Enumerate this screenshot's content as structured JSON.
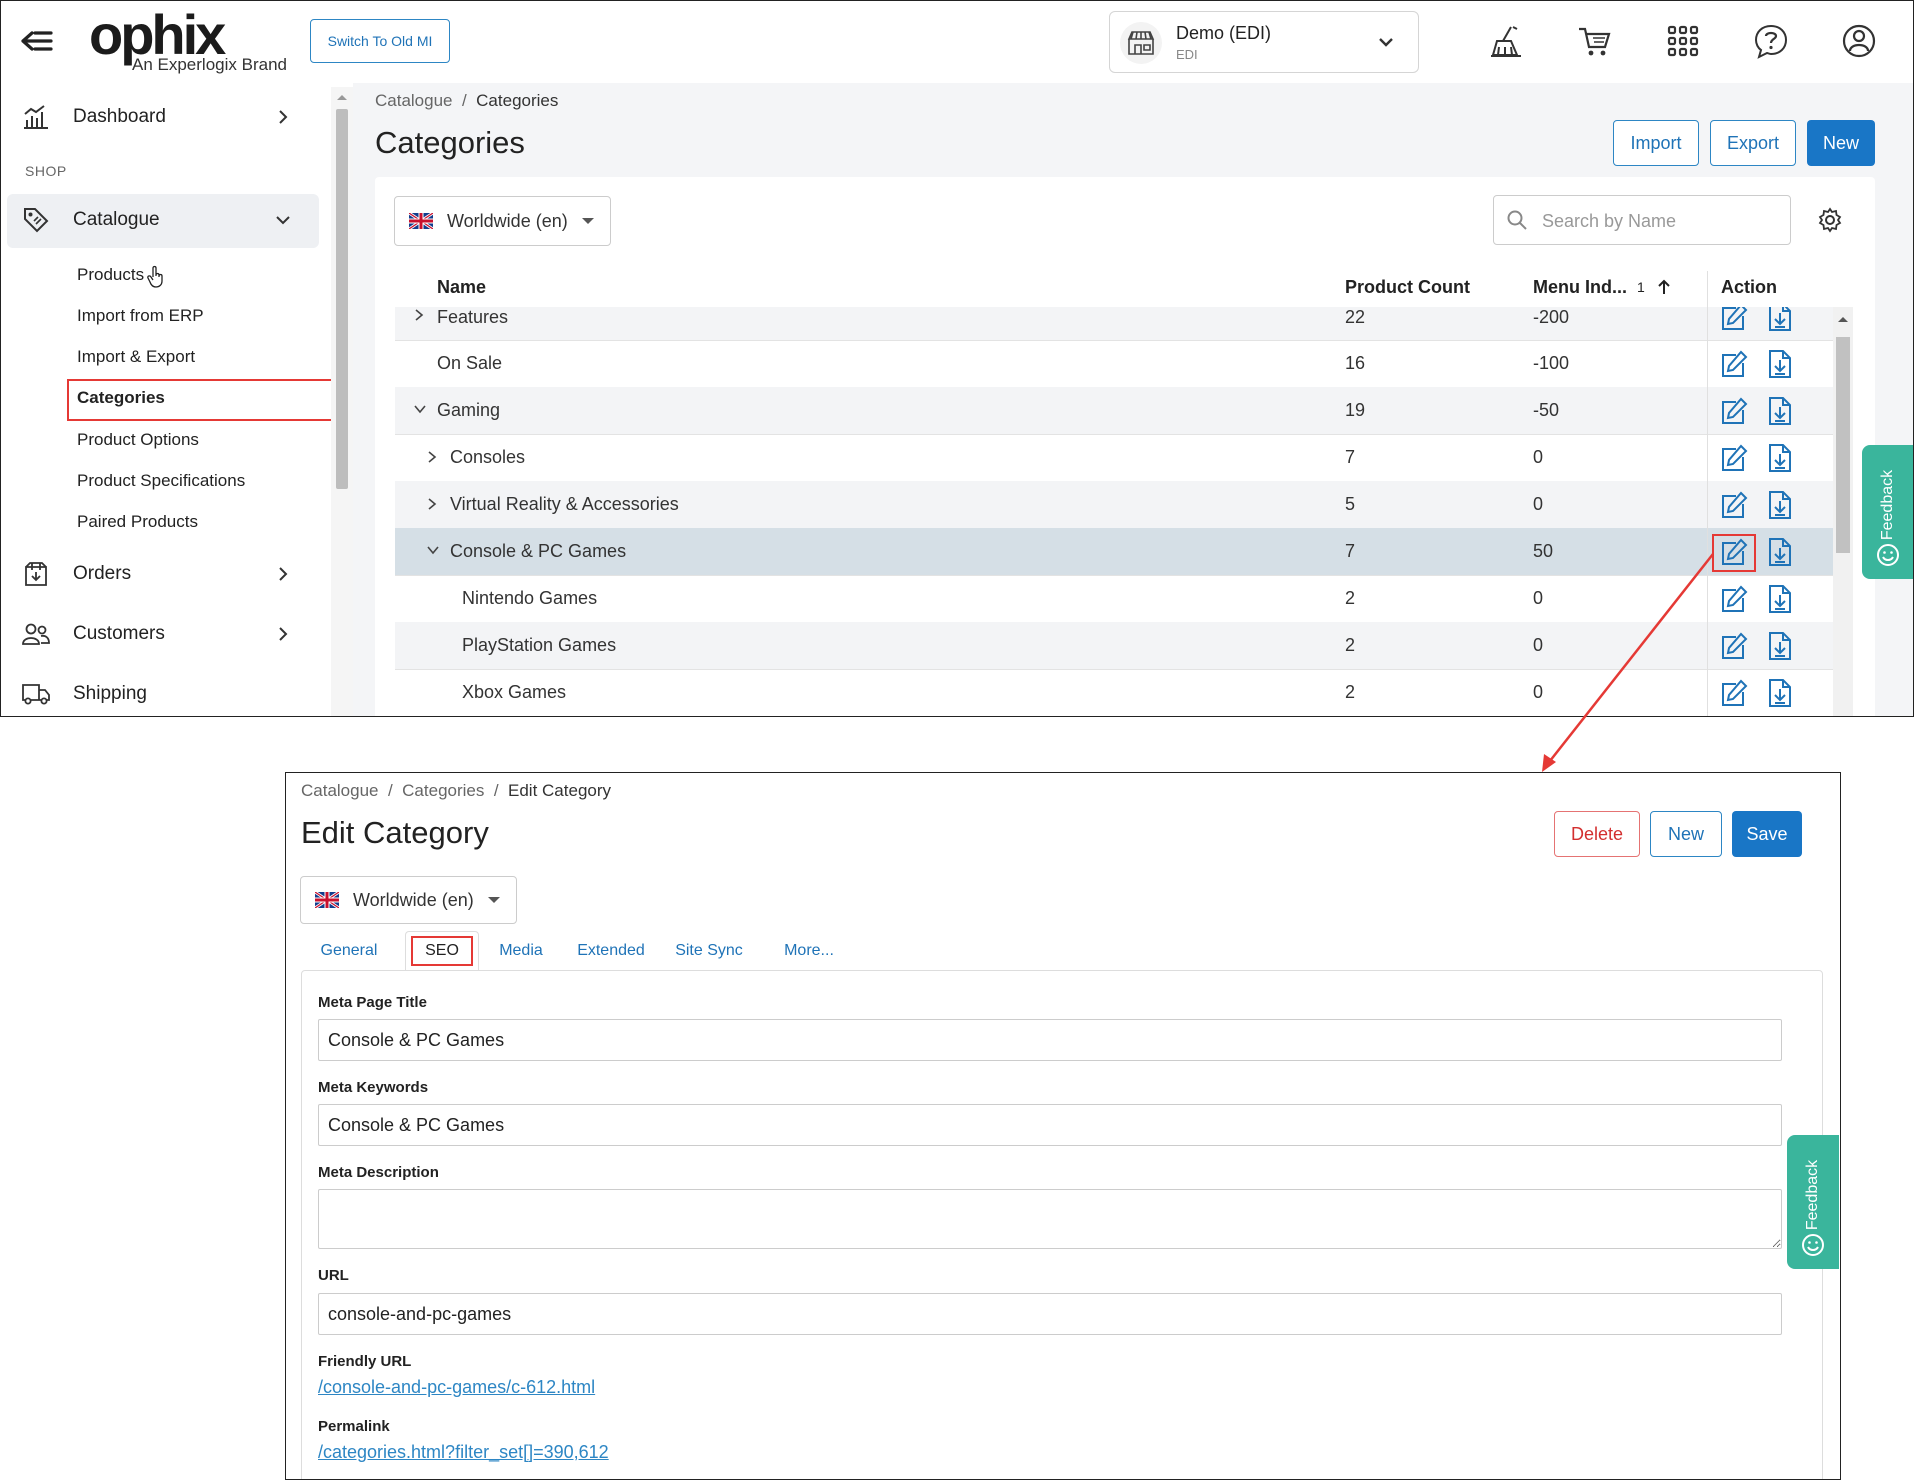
{
  "header": {
    "logo_text": "ophix",
    "logo_subtitle": "An Experlogix Brand",
    "switch_button": "Switch To Old MI",
    "store": {
      "name": "Demo (EDI)",
      "code": "EDI"
    },
    "icons": [
      "broom-icon",
      "cart-icon",
      "apps-grid-icon",
      "help-icon",
      "user-icon"
    ]
  },
  "sidebar": {
    "dashboard": "Dashboard",
    "section_shop": "SHOP",
    "catalogue": "Catalogue",
    "catalogue_items": [
      "Products",
      "Import from ERP",
      "Import & Export",
      "Categories",
      "Product Options",
      "Product Specifications",
      "Paired Products"
    ],
    "orders": "Orders",
    "customers": "Customers",
    "shipping": "Shipping"
  },
  "categories_page": {
    "breadcrumb": {
      "root": "Catalogue",
      "sep": "/",
      "current": "Categories"
    },
    "title": "Categories",
    "buttons": {
      "import": "Import",
      "export": "Export",
      "new": "New"
    },
    "locale": "Worldwide (en)",
    "search_placeholder": "Search by Name",
    "columns": {
      "name": "Name",
      "product_count": "Product Count",
      "menu_index": "Menu Ind...",
      "sort_index": "1",
      "action": "Action"
    },
    "rows": [
      {
        "name": "Features",
        "count": "22",
        "menu_index": "-200"
      },
      {
        "name": "On Sale",
        "count": "16",
        "menu_index": "-100"
      },
      {
        "name": "Gaming",
        "count": "19",
        "menu_index": "-50"
      },
      {
        "name": "Consoles",
        "count": "7",
        "menu_index": "0"
      },
      {
        "name": "Virtual Reality & Accessories",
        "count": "5",
        "menu_index": "0"
      },
      {
        "name": "Console & PC Games",
        "count": "7",
        "menu_index": "50"
      },
      {
        "name": "Nintendo Games",
        "count": "2",
        "menu_index": "0"
      },
      {
        "name": "PlayStation Games",
        "count": "2",
        "menu_index": "0"
      },
      {
        "name": "Xbox Games",
        "count": "2",
        "menu_index": "0"
      }
    ],
    "feedback": "Feedback"
  },
  "edit_page": {
    "breadcrumb": {
      "root": "Catalogue",
      "middle": "Categories",
      "sep": "/",
      "current": "Edit Category"
    },
    "title": "Edit Category",
    "buttons": {
      "delete": "Delete",
      "new": "New",
      "save": "Save"
    },
    "locale": "Worldwide (en)",
    "tabs": [
      "General",
      "SEO",
      "Media",
      "Extended",
      "Site Sync",
      "More..."
    ],
    "fields": {
      "meta_title_label": "Meta Page Title",
      "meta_title_value": "Console & PC Games",
      "meta_keywords_label": "Meta Keywords",
      "meta_keywords_value": "Console & PC Games",
      "meta_description_label": "Meta Description",
      "meta_description_value": "",
      "url_label": "URL",
      "url_value": "console-and-pc-games",
      "friendly_url_label": "Friendly URL",
      "friendly_url_value": "/console-and-pc-games/c-612.html",
      "permalink_label": "Permalink",
      "permalink_value": "/categories.html?filter_set[]=390,612"
    },
    "feedback": "Feedback"
  },
  "colors": {
    "primary": "#1976c6",
    "highlight_box": "#e53935",
    "feedback": "#3ab59c",
    "selected_row": "#d5dfe6"
  }
}
